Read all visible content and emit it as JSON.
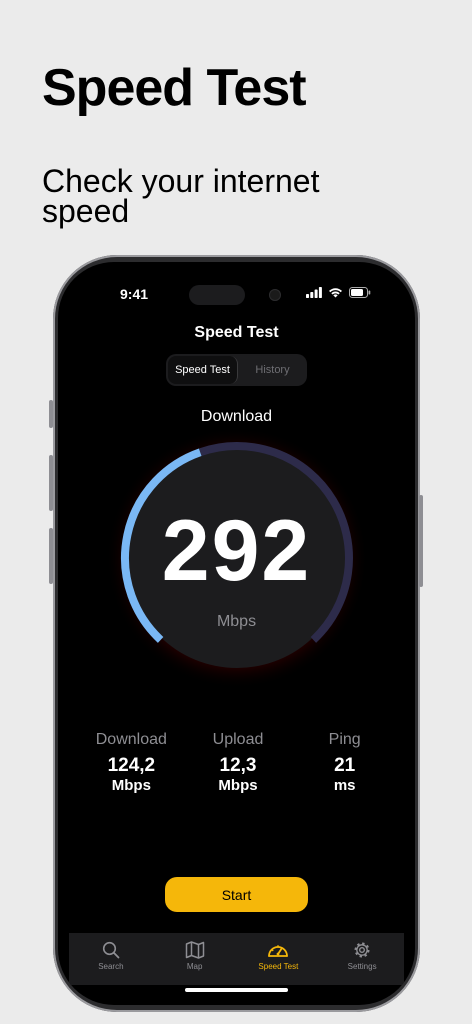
{
  "promo": {
    "title": "Speed Test",
    "subtitle": "Check your internet speed"
  },
  "status_bar": {
    "time": "9:41",
    "icons": [
      "signal-icon",
      "wifi-icon",
      "battery-icon"
    ]
  },
  "nav": {
    "title": "Speed Test"
  },
  "segmented": {
    "options": [
      "Speed Test",
      "History"
    ],
    "selected": "Speed Test"
  },
  "gauge": {
    "label": "Download",
    "value": "292",
    "unit": "Mbps",
    "progress_fraction": 0.43,
    "colors": {
      "progress": "#7ab8f5",
      "remainder": "#2d2b4a",
      "glow": "#c00000",
      "dial": "#1c1c1e"
    }
  },
  "stats": [
    {
      "label": "Download",
      "value": "124,2",
      "unit": "Mbps"
    },
    {
      "label": "Upload",
      "value": "12,3",
      "unit": "Mbps"
    },
    {
      "label": "Ping",
      "value": "21",
      "unit": "ms"
    }
  ],
  "start_button": {
    "label": "Start",
    "color": "#f5b70a"
  },
  "tabbar": {
    "items": [
      {
        "label": "Search",
        "icon": "search-icon"
      },
      {
        "label": "Map",
        "icon": "map-icon"
      },
      {
        "label": "Speed Test",
        "icon": "speedometer-icon",
        "active": true
      },
      {
        "label": "Settings",
        "icon": "gear-icon"
      }
    ]
  }
}
